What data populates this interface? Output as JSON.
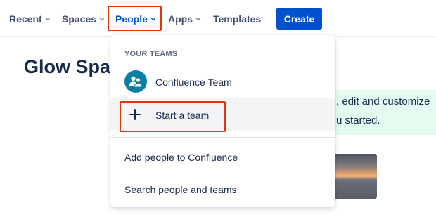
{
  "nav": {
    "recent": "Recent",
    "spaces": "Spaces",
    "people": "People",
    "apps": "Apps",
    "templates": "Templates",
    "create": "Create"
  },
  "page": {
    "title": "Glow Spac",
    "banner_line1": ", edit and customize",
    "banner_line2": "u started."
  },
  "dropdown": {
    "heading": "YOUR TEAMS",
    "team_name": "Confluence Team",
    "start_team": "Start a team",
    "add_people": "Add people to Confluence",
    "search_people": "Search people and teams"
  },
  "colors": {
    "primary": "#0052cc",
    "highlight_box": "#de350b",
    "banner_bg": "#e3fcef",
    "team_avatar": "#0a7ea4"
  },
  "icons": {
    "nav_chevron": "chevron-down-icon",
    "team_avatar": "team-people-icon",
    "start_team": "plus-icon"
  }
}
